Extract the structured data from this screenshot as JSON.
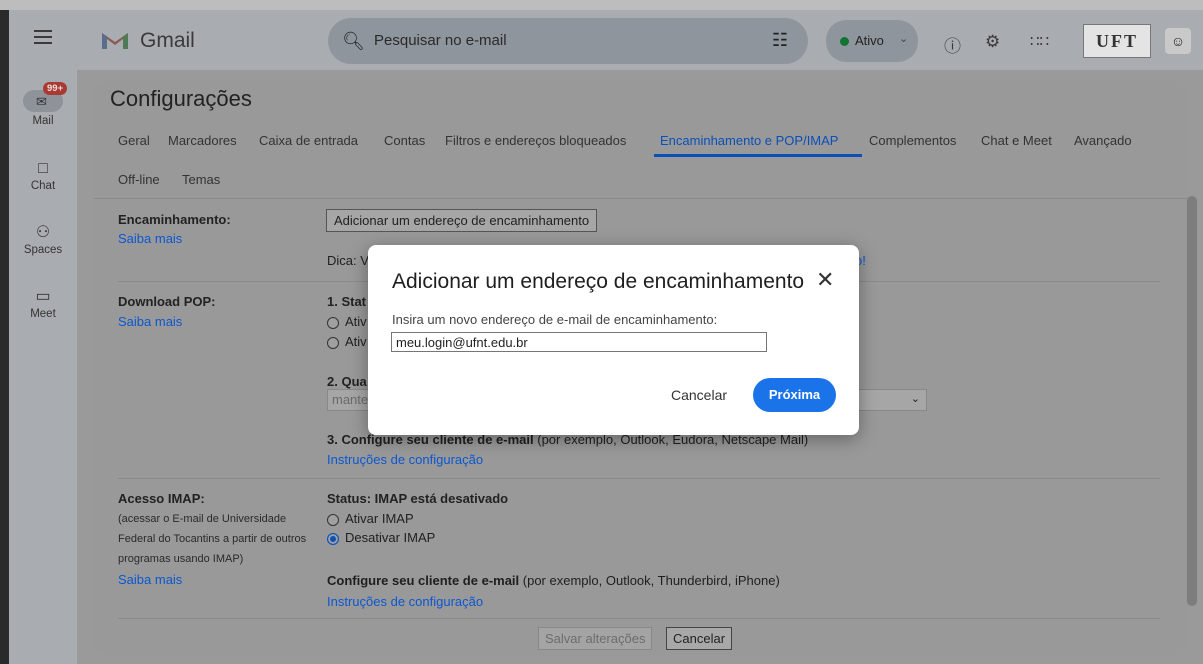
{
  "app": {
    "name": "Gmail"
  },
  "search": {
    "placeholder": "Pesquisar no e-mail"
  },
  "status": {
    "label": "Ativo"
  },
  "brand_badge": "UFT",
  "rail": {
    "mail_badge": "99+",
    "items": [
      {
        "label": "Mail"
      },
      {
        "label": "Chat"
      },
      {
        "label": "Spaces"
      },
      {
        "label": "Meet"
      }
    ]
  },
  "settings": {
    "title": "Configurações",
    "tabs": [
      "Geral",
      "Marcadores",
      "Caixa de entrada",
      "Contas",
      "Filtros e endereços bloqueados",
      "Encaminhamento e POP/IMAP",
      "Complementos",
      "Chat e Meet",
      "Avançado",
      "Off-line",
      "Temas"
    ],
    "forwarding": {
      "title": "Encaminhamento:",
      "learn_more": "Saiba mais",
      "add_button": "Adicionar um endereço de encaminhamento",
      "tip_prefix": "Dica: V",
      "tip_suffix": "o!"
    },
    "pop": {
      "title": "Download POP:",
      "learn_more": "Saiba mais",
      "status_partial": "1. Stat",
      "opt1_partial": "Ativ",
      "opt2_partial": "Ativ",
      "q2_partial": "2. Qua",
      "select_partial": "mante",
      "step3_bold": "3. Configure seu cliente de e-mail",
      "step3_rest": " (por exemplo, Outlook, Eudora, Netscape Mail)",
      "instructions": "Instruções de configuração"
    },
    "imap": {
      "title": "Acesso IMAP:",
      "desc_lines": [
        "(acessar o E-mail de Universidade",
        "Federal do Tocantins a partir de outros",
        "programas usando IMAP)"
      ],
      "learn_more": "Saiba mais",
      "status": "Status: IMAP está desativado",
      "enable": "Ativar IMAP",
      "disable": "Desativar IMAP",
      "selected": "disable",
      "config_bold": "Configure seu cliente de e-mail",
      "config_rest": " (por exemplo, Outlook, Thunderbird, iPhone)",
      "instructions": "Instruções de configuração"
    },
    "footer": {
      "save": "Salvar alterações",
      "cancel": "Cancelar"
    }
  },
  "modal": {
    "title": "Adicionar um endereço de encaminhamento",
    "label": "Insira um novo endereço de e-mail de encaminhamento:",
    "input_value": "meu.login@ufnt.edu.br",
    "cancel": "Cancelar",
    "next": "Próxima"
  },
  "colors": {
    "accent": "#1a73e8",
    "active_status": "#137333"
  }
}
